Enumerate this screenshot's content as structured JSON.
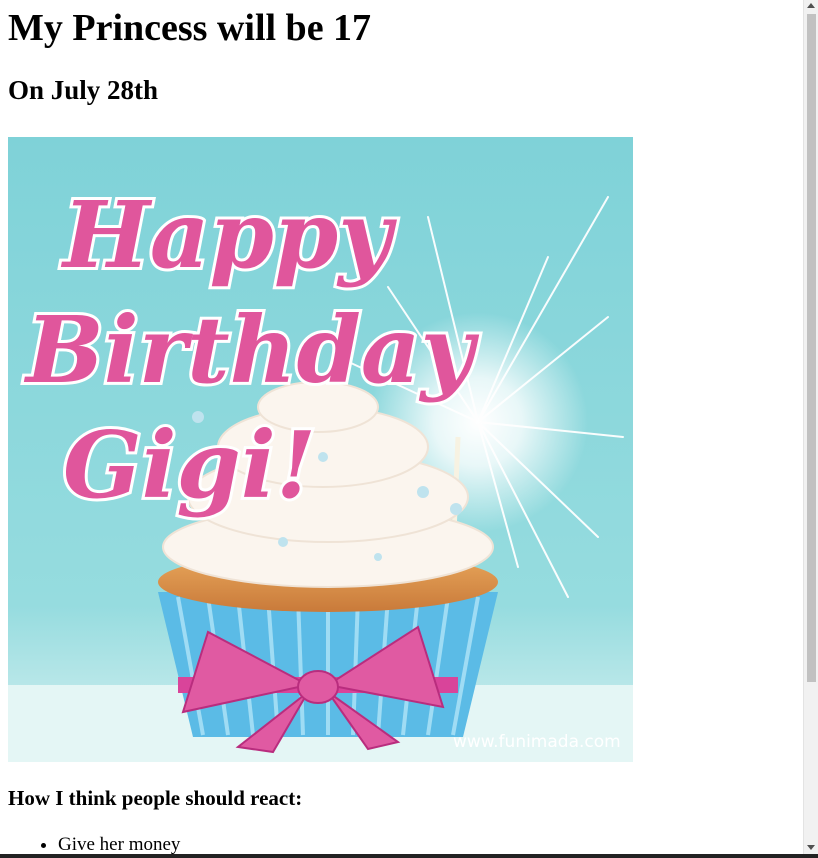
{
  "heading": "My Princess will be 17",
  "subheading": "On July 28th",
  "image": {
    "line1": "Happy",
    "line2": "Birthday",
    "line3": "Gigi!",
    "watermark": "www.funimada.com",
    "colors": {
      "background": "#8fd8dc",
      "text_pink": "#e0569c",
      "cup_blue": "#5bbbe6",
      "bow_pink": "#d9449a",
      "frosting": "#fbf5ee"
    }
  },
  "reactions_title": "How I think people should react:",
  "reactions": [
    "Give her money"
  ]
}
